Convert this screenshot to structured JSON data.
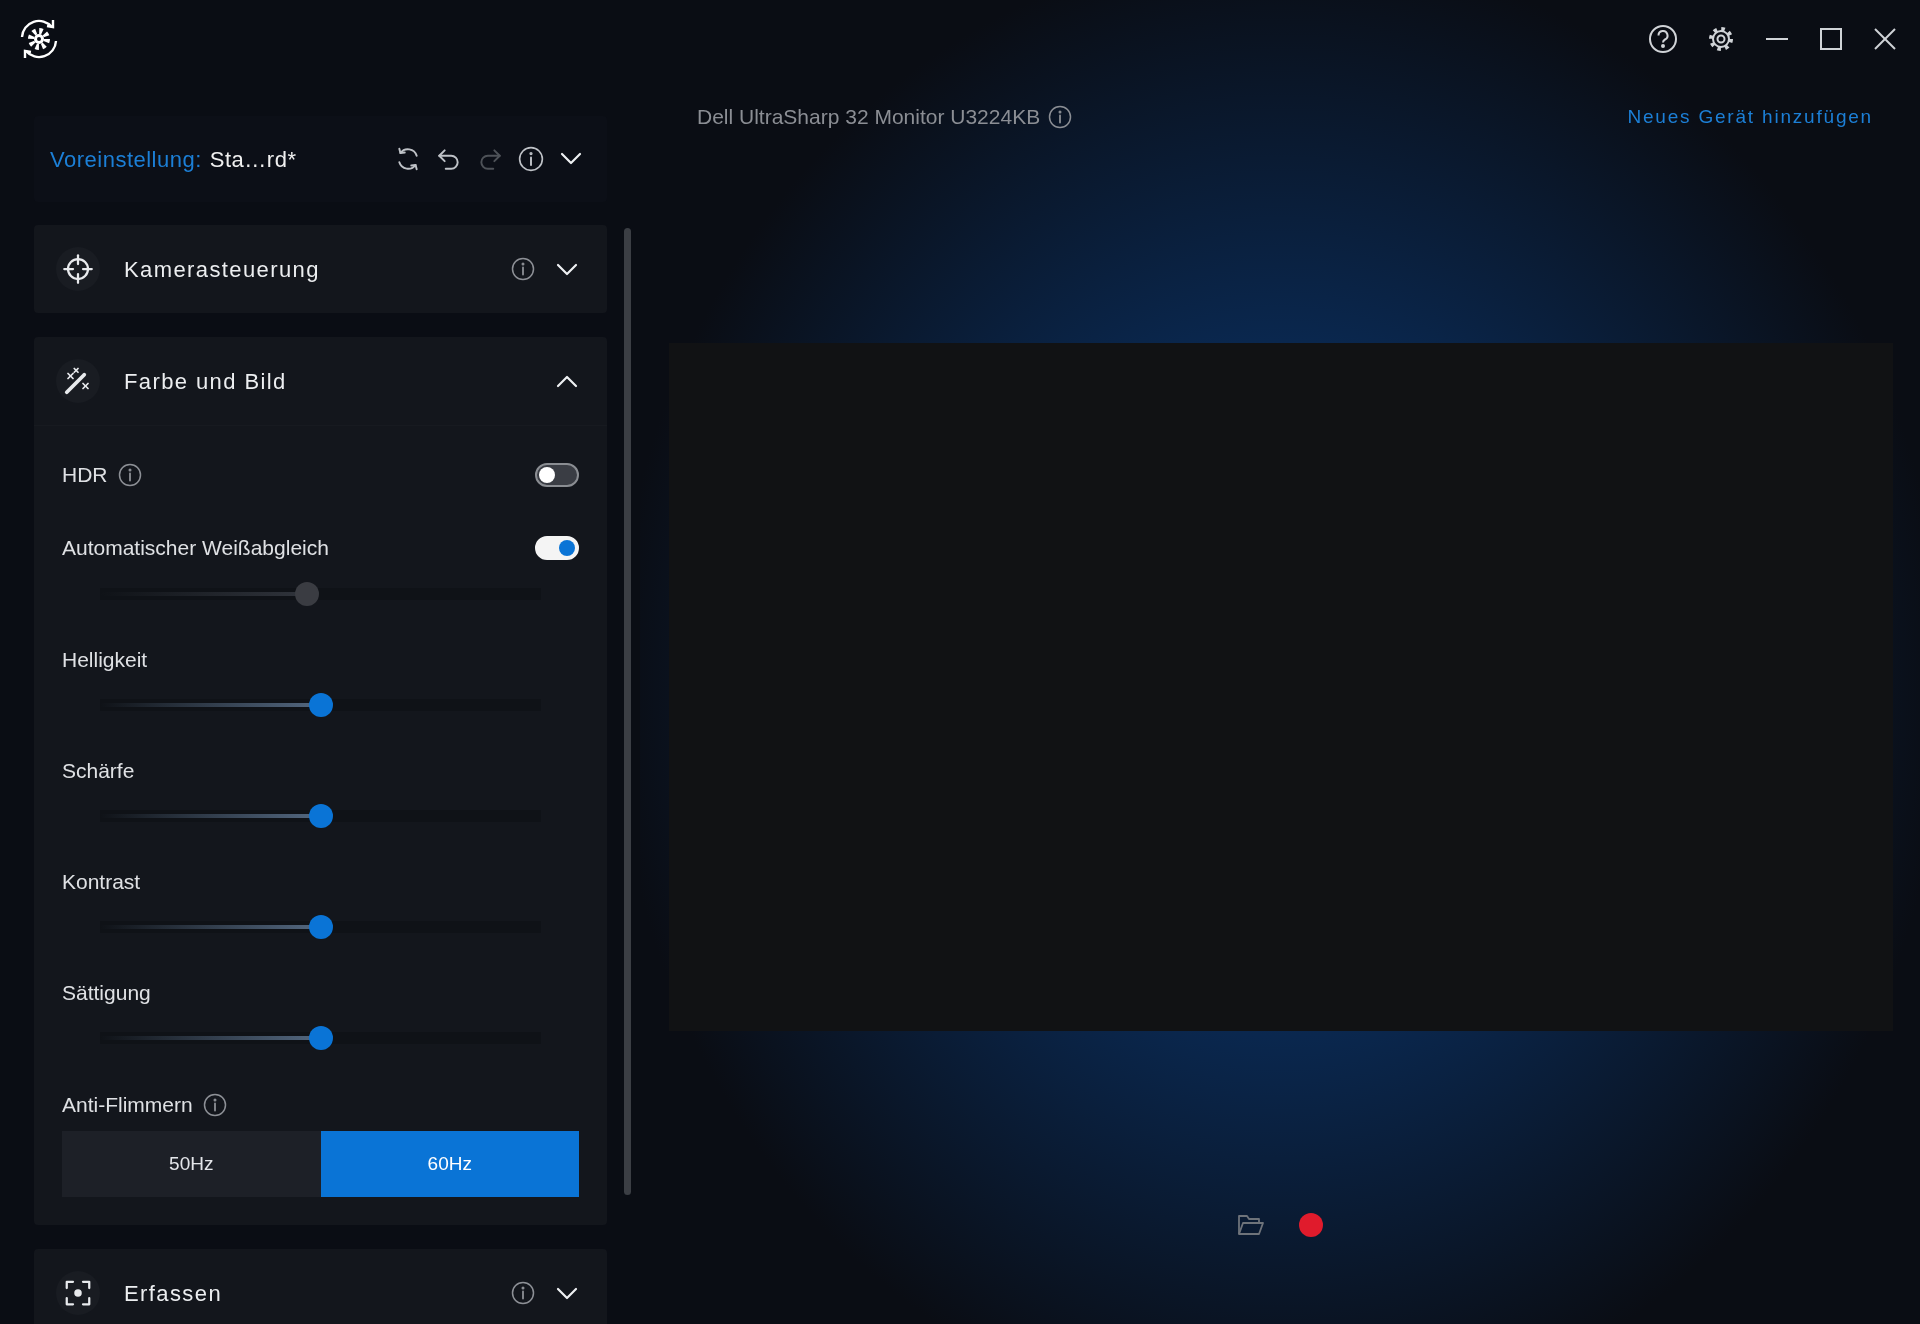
{
  "device": {
    "name": "Dell UltraSharp 32 Monitor U3224KB",
    "info": true
  },
  "add_device": {
    "label": "Neues Gerät hinzufügen"
  },
  "preset": {
    "label": "Voreinstellung:",
    "value": "Sta…rd*",
    "actions": [
      {
        "kind": "reset",
        "disabled": false
      },
      {
        "kind": "undo",
        "disabled": false
      },
      {
        "kind": "redo",
        "disabled": true
      },
      {
        "kind": "info",
        "disabled": false
      }
    ],
    "expanded": false
  },
  "sections": [
    {
      "kind": "camera",
      "title": "Kamerasteuerung",
      "info": true,
      "expanded": false
    },
    {
      "kind": "color",
      "title": "Farbe und Bild",
      "info": false,
      "expanded": true,
      "controls": [
        {
          "kind": "toggle",
          "label": "HDR",
          "info": true,
          "on": false
        },
        {
          "kind": "toggle",
          "label": "Automatischer Weißabgleich",
          "info": false,
          "on": true
        },
        {
          "kind": "slider",
          "disabled": true,
          "level": 0.47
        },
        {
          "kind": "slider",
          "label": "Helligkeit",
          "disabled": false,
          "level": 0.5
        },
        {
          "kind": "slider",
          "label": "Schärfe",
          "disabled": false,
          "level": 0.5
        },
        {
          "kind": "slider",
          "label": "Kontrast",
          "disabled": false,
          "level": 0.5
        },
        {
          "kind": "slider",
          "label": "Sättigung",
          "disabled": false,
          "level": 0.5
        },
        {
          "kind": "segmented",
          "label": "Anti-Flimmern",
          "info": true,
          "options": [
            {
              "label": "50Hz",
              "selected": false
            },
            {
              "label": "60Hz",
              "selected": true
            }
          ]
        }
      ]
    },
    {
      "kind": "capture",
      "title": "Erfassen",
      "info": true,
      "expanded": false
    }
  ]
}
